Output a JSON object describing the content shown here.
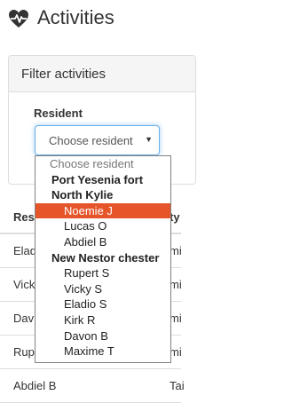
{
  "header": {
    "title": "Activities",
    "icon": "heartbeat-icon"
  },
  "filter_panel": {
    "title": "Filter activities",
    "resident_label": "Resident",
    "select_value": "Choose resident"
  },
  "table": {
    "headers": [
      "Resi",
      "ty"
    ],
    "rows": [
      [
        "Elad",
        "mi"
      ],
      [
        "Vick",
        "mi"
      ],
      [
        "Dav",
        "mi"
      ],
      [
        "Rup",
        "mi"
      ],
      [
        "Abdiel B",
        "Tai"
      ]
    ]
  },
  "dropdown": {
    "placeholder": "Choose resident",
    "groups": [
      {
        "label": "Port Yesenia fort",
        "items": []
      },
      {
        "label": "North Kylie",
        "items": [
          "Noemie J",
          "Lucas O",
          "Abdiel B"
        ]
      },
      {
        "label": "New Nestor chester",
        "items": [
          "Rupert S",
          "Vicky S",
          "Eladio S",
          "Kirk R",
          "Davon B",
          "Maxime T"
        ]
      }
    ],
    "highlighted": "Noemie J"
  },
  "colors": {
    "highlight": "#e6552a",
    "focus_border": "#66afe9"
  }
}
